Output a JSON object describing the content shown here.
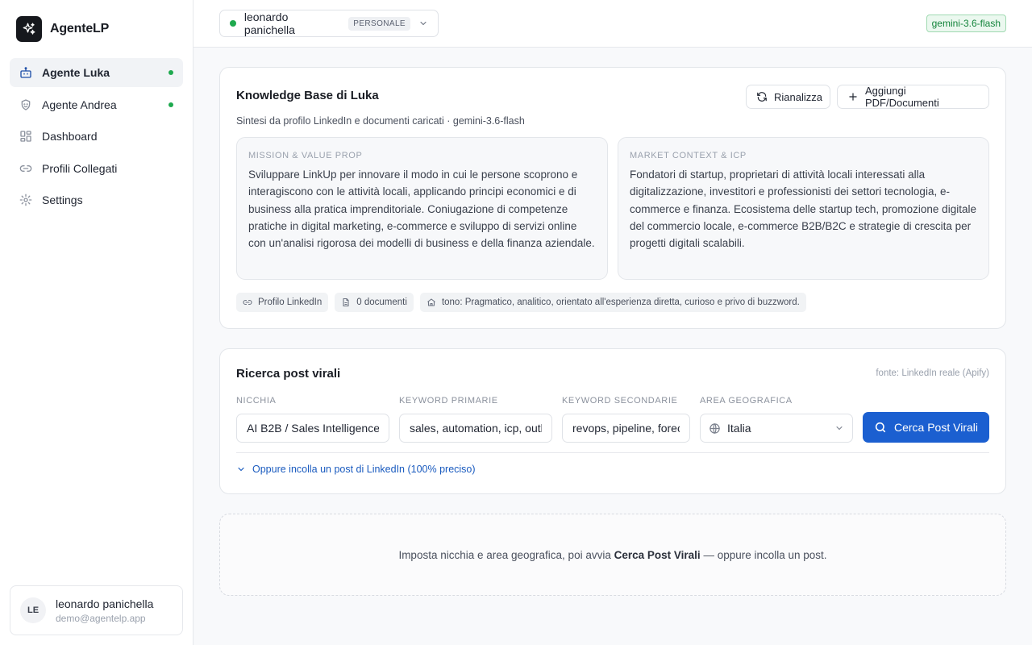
{
  "brand": {
    "name": "AgenteLP"
  },
  "sidebar": {
    "items": [
      {
        "label": "Agente Luka",
        "icon": "bot-icon",
        "active": true,
        "status_dot": true
      },
      {
        "label": "Agente Andrea",
        "icon": "face-icon",
        "active": false,
        "status_dot": true
      },
      {
        "label": "Dashboard",
        "icon": "dashboard-icon",
        "active": false,
        "status_dot": false
      },
      {
        "label": "Profili Collegati",
        "icon": "link-icon",
        "active": false,
        "status_dot": false
      },
      {
        "label": "Settings",
        "icon": "gear-icon",
        "active": false,
        "status_dot": false
      }
    ],
    "user": {
      "initials": "LE",
      "name": "leonardo panichella",
      "email": "demo@agentelp.app"
    }
  },
  "topbar": {
    "profile_name": "leonardo panichella",
    "profile_badge": "PERSONALE",
    "model_badge": "gemini-3.6-flash"
  },
  "kb": {
    "title": "Knowledge Base di Luka",
    "subtitle": "Sintesi da profilo LinkedIn e documenti caricati · gemini-3.6-flash",
    "reanalyze_label": "Rianalizza",
    "add_label": "Aggiungi PDF/Documenti",
    "mission_label": "MISSION & VALUE PROP",
    "mission_text": "Sviluppare LinkUp per innovare il modo in cui le persone scoprono e interagiscono con le attività locali, applicando principi economici e di business alla pratica imprenditoriale. Coniugazione di competenze pratiche in digital marketing, e-commerce e sviluppo di servizi online con un'analisi rigorosa dei modelli di business e della finanza aziendale.",
    "market_label": "MARKET CONTEXT & ICP",
    "market_text": "Fondatori di startup, proprietari di attività locali interessati alla digitalizzazione, investitori e professionisti dei settori tecnologia, e-commerce e finanza. Ecosistema delle startup tech, promozione digitale del commercio locale, e-commerce B2B/B2C e strategie di crescita per progetti digitali scalabili.",
    "chips": {
      "linkedin": "Profilo LinkedIn",
      "docs": "0 documenti",
      "tone": "tono: Pragmatico, analitico, orientato all'esperienza diretta, curioso e privo di buzzword."
    }
  },
  "search": {
    "title": "Ricerca post virali",
    "source": "fonte: LinkedIn reale (Apify)",
    "niche_label": "NICCHIA",
    "niche_value": "AI B2B / Sales Intelligence",
    "primary_label": "KEYWORD PRIMARIE",
    "primary_value": "sales, automation, icp, outbound",
    "secondary_label": "KEYWORD SECONDARIE",
    "secondary_value": "revops, pipeline, forecasting",
    "geo_label": "AREA GEOGRAFICA",
    "geo_value": "Italia",
    "button_label": "Cerca Post Virali",
    "paste_label": "Oppure incolla un post di LinkedIn (100% preciso)"
  },
  "empty": {
    "pre": "Imposta nicchia e area geografica, poi avvia",
    "strong": "Cerca Post Virali",
    "post": "— oppure incolla un post."
  },
  "colors": {
    "primary": "#1b5fd0",
    "status_green": "#1ea94e",
    "link_blue": "#1a5bbf"
  }
}
